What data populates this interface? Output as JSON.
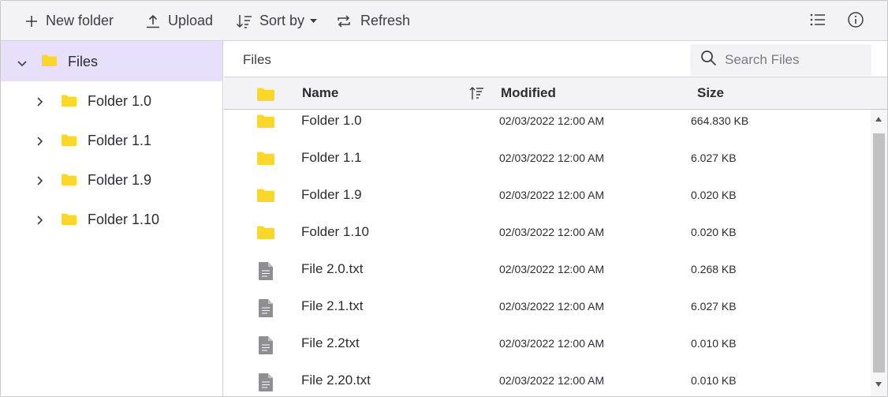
{
  "toolbar": {
    "new_folder_label": "New folder",
    "upload_label": "Upload",
    "sort_by_label": "Sort by",
    "refresh_label": "Refresh"
  },
  "tree": {
    "root_label": "Files",
    "items": [
      {
        "label": "Folder 1.0"
      },
      {
        "label": "Folder 1.1"
      },
      {
        "label": "Folder 1.9"
      },
      {
        "label": "Folder 1.10"
      }
    ]
  },
  "address": {
    "path_label": "Files"
  },
  "search": {
    "placeholder": "Search Files",
    "value": ""
  },
  "grid": {
    "columns": {
      "name": "Name",
      "modified": "Modified",
      "size": "Size"
    },
    "rows": [
      {
        "type": "folder",
        "name": "Folder 1.0",
        "modified": "02/03/2022 12:00 AM",
        "size": "664.830 KB"
      },
      {
        "type": "folder",
        "name": "Folder 1.1",
        "modified": "02/03/2022 12:00 AM",
        "size": "6.027 KB"
      },
      {
        "type": "folder",
        "name": "Folder 1.9",
        "modified": "02/03/2022 12:00 AM",
        "size": "0.020 KB"
      },
      {
        "type": "folder",
        "name": "Folder 1.10",
        "modified": "02/03/2022 12:00 AM",
        "size": "0.020 KB"
      },
      {
        "type": "file",
        "name": "File 2.0.txt",
        "modified": "02/03/2022 12:00 AM",
        "size": "0.268 KB"
      },
      {
        "type": "file",
        "name": "File 2.1.txt",
        "modified": "02/03/2022 12:00 AM",
        "size": "6.027 KB"
      },
      {
        "type": "file",
        "name": "File 2.2txt",
        "modified": "02/03/2022 12:00 AM",
        "size": "0.010 KB"
      },
      {
        "type": "file",
        "name": "File 2.20.txt",
        "modified": "02/03/2022 12:00 AM",
        "size": "0.010 KB"
      }
    ]
  },
  "colors": {
    "accent_selected": "#e8e0fb",
    "toolbar_bg": "#f3f2f7",
    "folder_yellow": "#fcd72b",
    "file_gray": "#8e8e93"
  },
  "icons": {
    "toolbar": [
      "plus-icon",
      "upload-icon",
      "sort-icon",
      "chevron-down-icon",
      "refresh-icon",
      "list-view-icon",
      "info-icon"
    ],
    "tree": [
      "chevron-down-icon",
      "chevron-right-icon",
      "folder-icon"
    ],
    "search": "search-icon",
    "grid": [
      "folder-icon",
      "file-icon",
      "sort-ascending-icon"
    ]
  }
}
